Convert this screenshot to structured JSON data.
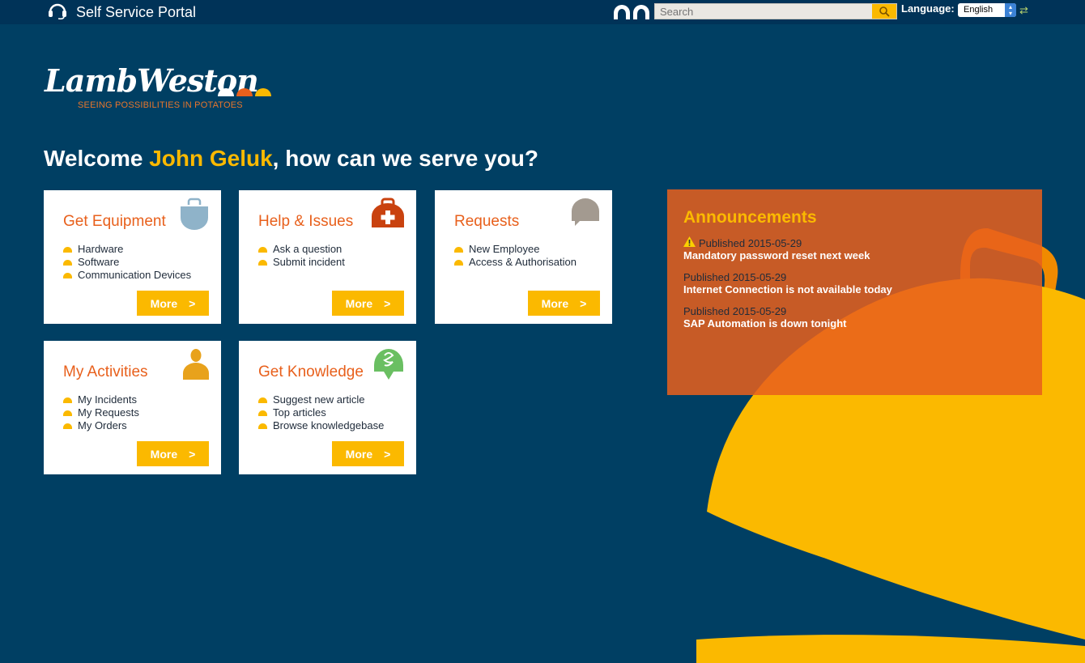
{
  "topbar": {
    "portal_title": "Self Service Portal",
    "search_placeholder": "Search",
    "language_label": "Language:",
    "language_value": "English"
  },
  "logo": {
    "wordmark": "LambWeston",
    "tagline": "SEEING POSSIBILITIES IN POTATOES"
  },
  "welcome": {
    "prefix": "Welcome ",
    "name": "John Geluk",
    "suffix": ", how can we serve you?"
  },
  "cards": [
    {
      "title": "Get Equipment",
      "items": [
        "Hardware",
        "Software",
        "Communication Devices"
      ],
      "more": "More",
      "icon": "bag-icon"
    },
    {
      "title": "Help & Issues",
      "items": [
        "Ask a question",
        "Submit incident"
      ],
      "more": "More",
      "icon": "first-aid-kit-icon"
    },
    {
      "title": "Requests",
      "items": [
        "New Employee",
        "Access & Authorisation"
      ],
      "more": "More",
      "icon": "speech-bubble-icon"
    },
    {
      "title": "My Activities",
      "items": [
        "My Incidents",
        "My Requests",
        "My Orders"
      ],
      "more": "More",
      "icon": "person-icon"
    },
    {
      "title": "Get Knowledge",
      "items": [
        "Suggest new article",
        "Top articles",
        "Browse knowledgebase"
      ],
      "more": "More",
      "icon": "lightbulb-icon"
    }
  ],
  "more_arrow": ">",
  "announcements": {
    "title": "Announcements",
    "items": [
      {
        "date": "Published 2015-05-29",
        "text": "Mandatory password reset next week",
        "warning": true
      },
      {
        "date": "Published 2015-05-29",
        "text": "Internet Connection is not available today",
        "warning": false
      },
      {
        "date": "Published 2015-05-29",
        "text": "SAP Automation is down tonight",
        "warning": false
      }
    ]
  },
  "colors": {
    "background": "#003f63",
    "accent_yellow": "#fbb900",
    "accent_orange": "#e8601c"
  }
}
